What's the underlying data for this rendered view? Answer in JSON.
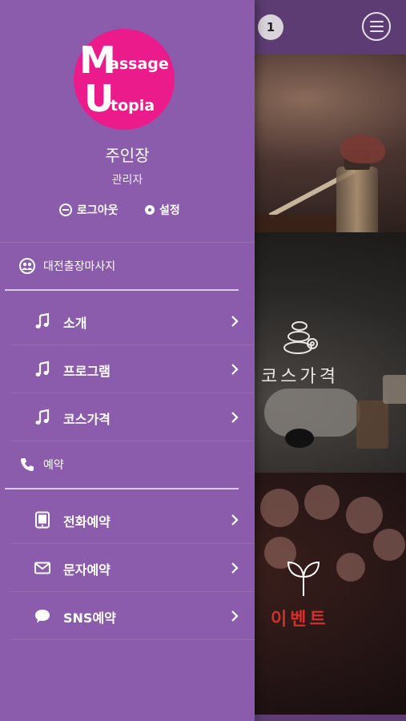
{
  "header": {
    "notification_count": "1",
    "menu_icon": "hamburger-menu-icon"
  },
  "logo": {
    "line1_big": "M",
    "line1_small": "assage",
    "line2_big": "U",
    "line2_small": "topia",
    "color": "#ec1b8c"
  },
  "user": {
    "name": "주인장",
    "role": "관리자",
    "logout_label": "로그아웃",
    "settings_label": "설정"
  },
  "sections": [
    {
      "label": "대전출장마사지",
      "icon": "users-icon"
    },
    {
      "label": "예약",
      "icon": "phone-icon"
    }
  ],
  "menu": [
    {
      "label": "소개",
      "icon": "music-note-icon"
    },
    {
      "label": "프로그램",
      "icon": "music-note-icon"
    },
    {
      "label": "코스가격",
      "icon": "music-note-icon"
    },
    {
      "label": "전화예약",
      "icon": "tablet-icon"
    },
    {
      "label": "문자예약",
      "icon": "envelope-icon"
    },
    {
      "label": "SNS예약",
      "icon": "chat-bubble-icon"
    }
  ],
  "background_panels": {
    "course_title": "코스가격",
    "event_title": "이벤트"
  },
  "colors": {
    "drawer_bg": "#8a5cab",
    "topbar_bg": "#5c3c72",
    "event_title": "#d2302a"
  }
}
